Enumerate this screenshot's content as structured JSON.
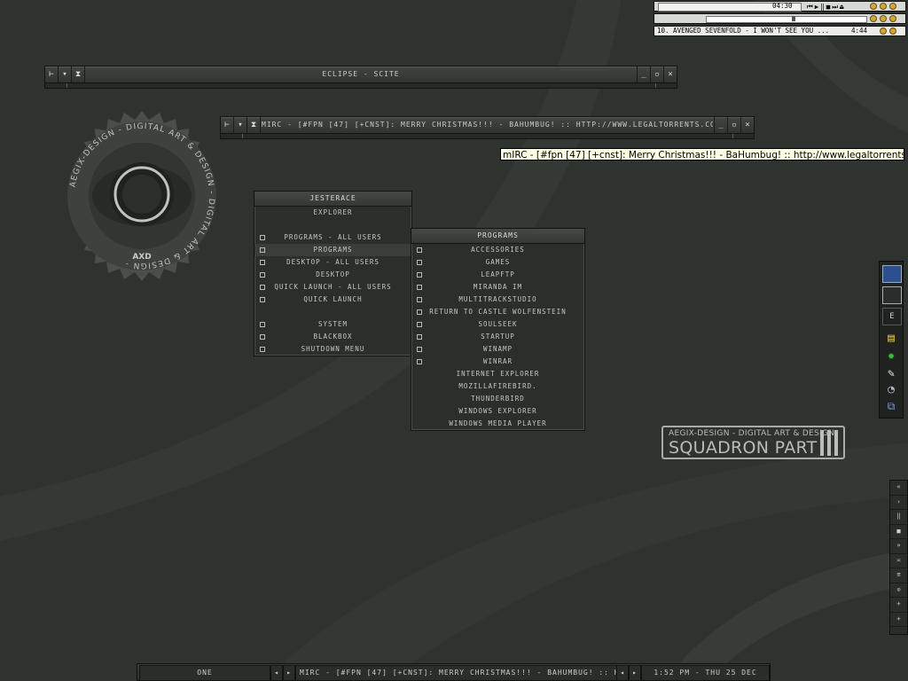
{
  "winamp": {
    "time": "04:30",
    "track": "10. AVENGED SEVENFOLD - I WON'T SEE YOU ...",
    "duration": "4:44",
    "controls": [
      "prev-icon",
      "play-icon",
      "pause-icon",
      "stop-icon",
      "next-icon",
      "eject-icon"
    ]
  },
  "windows": {
    "eclipse": {
      "title": "ECLIPSE - SCITE"
    },
    "mirc": {
      "title": "MIRC - [#FPN [47] [+CNST]: MERRY CHRISTMAS!!! - BAHUMBUG! :: HTTP://WWW.LEGALTORRENTS.COM/]"
    }
  },
  "tooltip": {
    "text": "mIRC - [#fpn [47] [+cnst]: Merry Christmas!!! - BaHumbug! :: http://www.legaltorrents.com/]"
  },
  "logo": {
    "ring_text": "AEGIX-DESIGN - DIGITAL ART & DESIGN - DIGITAL ART & DESIGN -",
    "center": "AXD"
  },
  "menu_main": {
    "title": "JESTERACE",
    "items": [
      {
        "label": "EXPLORER",
        "check": false
      },
      {
        "gap": true
      },
      {
        "label": "PROGRAMS - ALL USERS",
        "check": true
      },
      {
        "label": "PROGRAMS",
        "check": true,
        "active": true
      },
      {
        "label": "DESKTOP - ALL USERS",
        "check": true
      },
      {
        "label": "DESKTOP",
        "check": true
      },
      {
        "label": "QUICK LAUNCH - ALL USERS",
        "check": true
      },
      {
        "label": "QUICK LAUNCH",
        "check": true
      },
      {
        "gap": true
      },
      {
        "label": "SYSTEM",
        "check": true
      },
      {
        "label": "BLACKBOX",
        "check": true
      },
      {
        "label": "SHUTDOWN MENU",
        "check": true
      }
    ]
  },
  "menu_programs": {
    "title": "PROGRAMS",
    "items": [
      {
        "label": "ACCESSORIES",
        "check": true
      },
      {
        "label": "GAMES",
        "check": true
      },
      {
        "label": "LEAPFTP",
        "check": true
      },
      {
        "label": "MIRANDA IM",
        "check": true
      },
      {
        "label": "MULTITRACKSTUDIO",
        "check": true
      },
      {
        "label": "RETURN TO CASTLE WOLFENSTEIN",
        "check": true
      },
      {
        "label": "SOULSEEK",
        "check": true
      },
      {
        "label": "STARTUP",
        "check": true
      },
      {
        "label": "WINAMP",
        "check": true
      },
      {
        "label": "WINRAR",
        "check": true
      },
      {
        "label": "INTERNET EXPLORER",
        "check": false
      },
      {
        "label": "MOZILLAFIREBIRD.",
        "check": false
      },
      {
        "label": "THUNDERBIRD",
        "check": false
      },
      {
        "label": "WINDOWS EXPLORER",
        "check": false
      },
      {
        "label": "WINDOWS MEDIA PLAYER",
        "check": false
      }
    ]
  },
  "badge": {
    "top": "AEGIX-DESIGN - DIGITAL ART & DESIGN",
    "big": "SQUADRON PART"
  },
  "dock": [
    "computer-icon",
    "window-icon",
    "e-icon",
    "folder-icon",
    "gear-icon",
    "pen-icon",
    "satellite-icon",
    "network-icon"
  ],
  "media_controls": [
    "«",
    "›",
    "‖",
    "■",
    "»",
    "≍",
    "≡",
    "⊙",
    "+",
    "+"
  ],
  "taskbar": {
    "workspace": "ONE",
    "task": "MIRC - [#FPN [47] [+CNST]: MERRY CHRISTMAS!!! - BAHUMBUG! :: HTT...",
    "clock": "1:52 PM - THU 25 DEC"
  },
  "colors": {
    "background": "#2f332f",
    "tooltip_bg": "#ffffe6",
    "accent_gold": "#d3a63a"
  }
}
